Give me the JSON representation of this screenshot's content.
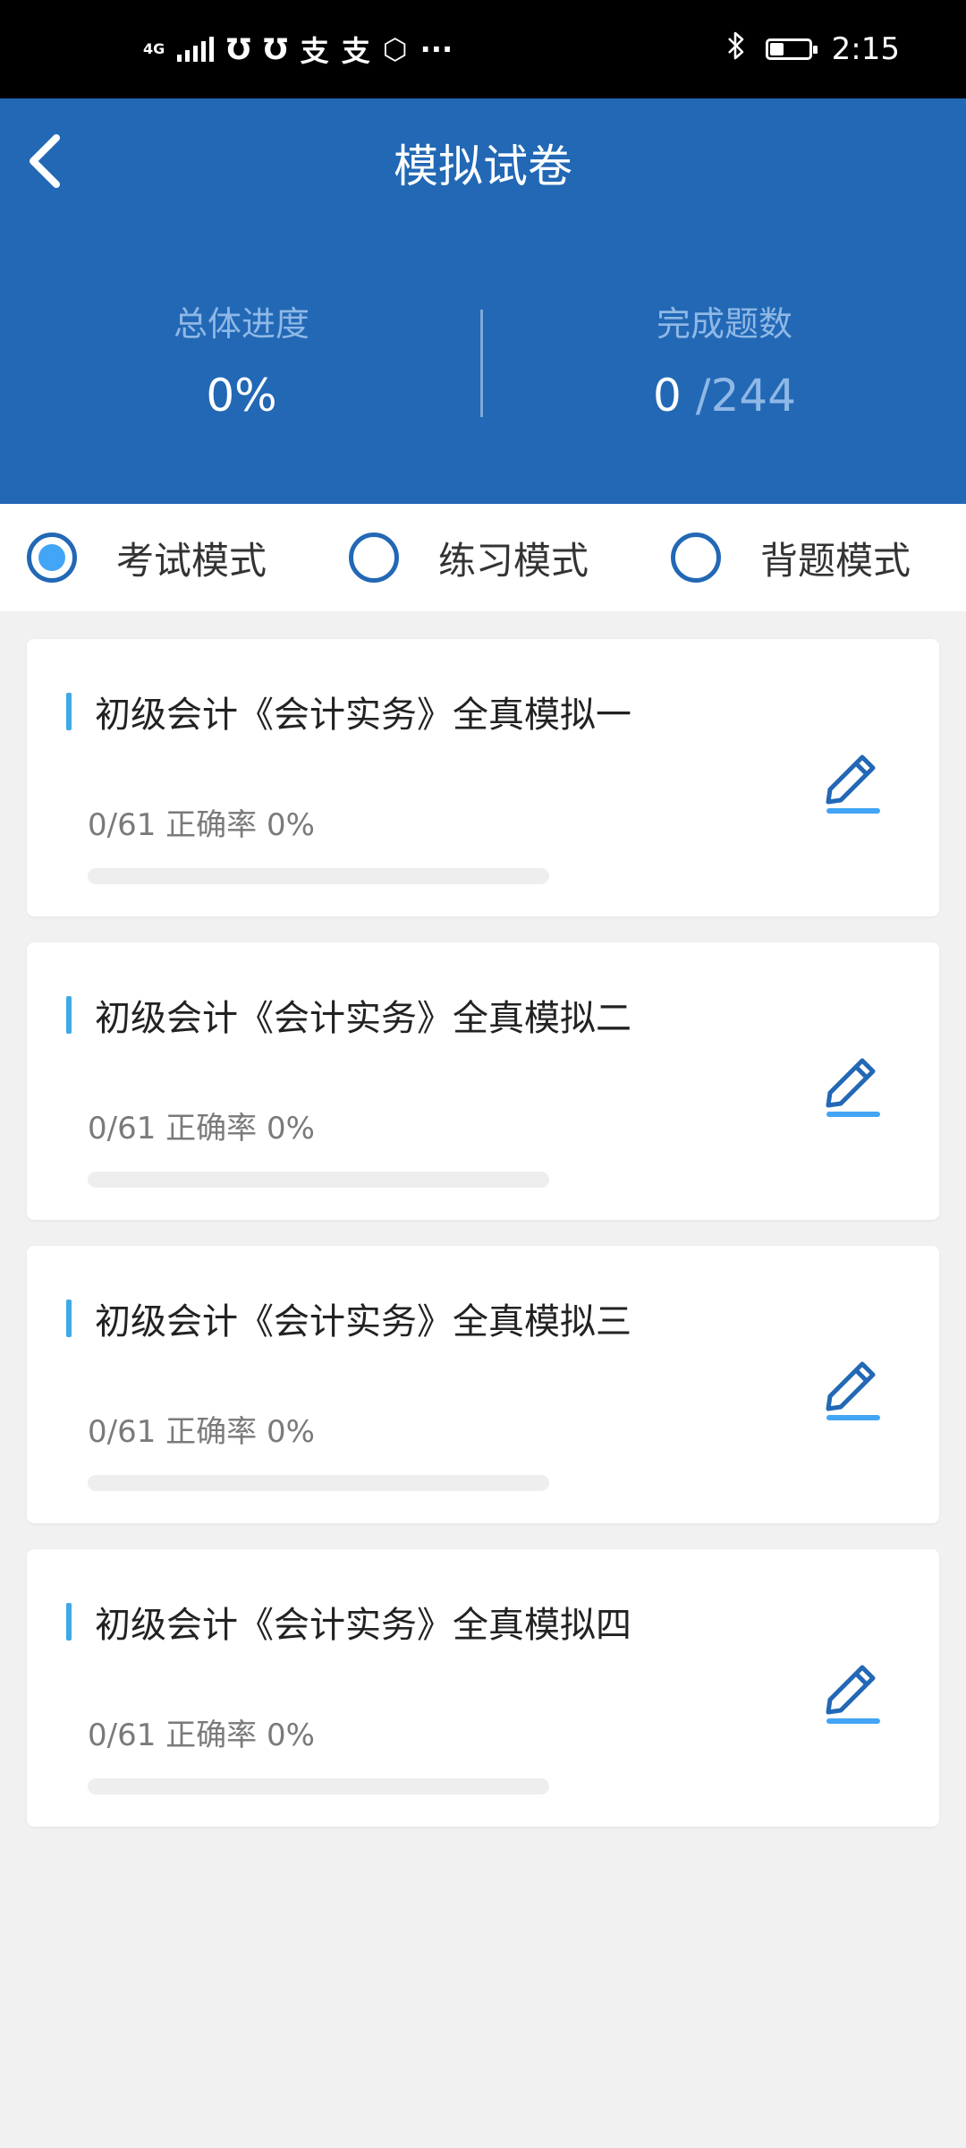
{
  "status_bar": {
    "network": "4G",
    "time": "2:15",
    "battery_level": 0.35,
    "icons": [
      "signal-icon",
      "notification-icon",
      "notification-icon",
      "alipay-icon",
      "alipay-icon",
      "hand-icon",
      "more-dots-icon",
      "bluetooth-icon",
      "battery-icon"
    ]
  },
  "header": {
    "title": "模拟试卷",
    "progress_label": "总体进度",
    "progress_value": "0%",
    "completed_label": "完成题数",
    "completed_value": "0",
    "completed_total": "/244"
  },
  "modes": [
    {
      "label": "考试模式",
      "selected": true
    },
    {
      "label": "练习模式",
      "selected": false
    },
    {
      "label": "背题模式",
      "selected": false
    }
  ],
  "papers": [
    {
      "title": "初级会计《会计实务》全真模拟一",
      "stats": "0/61 正确率 0%",
      "progress": 0
    },
    {
      "title": "初级会计《会计实务》全真模拟二",
      "stats": "0/61 正确率 0%",
      "progress": 0
    },
    {
      "title": "初级会计《会计实务》全真模拟三",
      "stats": "0/61 正确率 0%",
      "progress": 0
    },
    {
      "title": "初级会计《会计实务》全真模拟四",
      "stats": "0/61 正确率 0%",
      "progress": 0
    }
  ],
  "colors": {
    "primary": "#2268b5",
    "accent": "#42a5f5",
    "background": "#f1f1f1"
  }
}
